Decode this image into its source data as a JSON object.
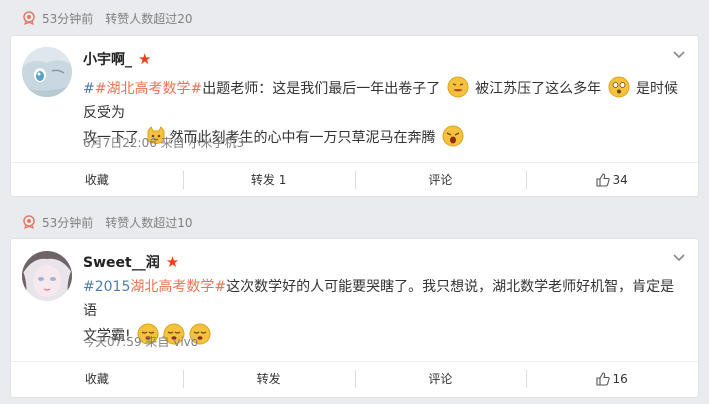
{
  "posts": [
    {
      "header_time": "53分钟前",
      "header_reposts": "转赞人数超过20",
      "username": "小宇啊_",
      "content_tag": "#湖北高考数学#",
      "content_p1": "出题老师：这是我们最后一年出卷子了",
      "content_p2": " 被江苏压了这么多年",
      "content_p3": " 是时候反受为",
      "content_p4": "攻一下了",
      "content_p5": "然而此刻考生的心中有一万只草泥马在奔腾",
      "meta": "6月7日22:06 来自 小米手机3",
      "actions": {
        "collect": "收藏",
        "repost": "转发 1",
        "comment": "评论",
        "like": "34"
      }
    },
    {
      "header_time": "53分钟前",
      "header_reposts": "转赞人数超过10",
      "username": "Sweet__润",
      "content_tag_a": "#2015",
      "content_tag_b": "湖北高考数学#",
      "content_p1": "这次数学好的人可能要哭瞎了。我只想说，湖北数学老师好机智，肯定是语",
      "content_p2": "文学霸!",
      "meta": "今天07:59 来自 vivo",
      "actions": {
        "collect": "收藏",
        "repost": "转发",
        "comment": "评论",
        "like": "16"
      }
    }
  ],
  "icons": {
    "hot": "hot-flame-icon",
    "verified": "star-icon",
    "more": "chevron-down-icon",
    "like": "thumb-up-icon"
  },
  "colors": {
    "tag": "#eb7350",
    "link": "#507daf",
    "star": "#f0401a",
    "bg": "#e9ebee"
  }
}
